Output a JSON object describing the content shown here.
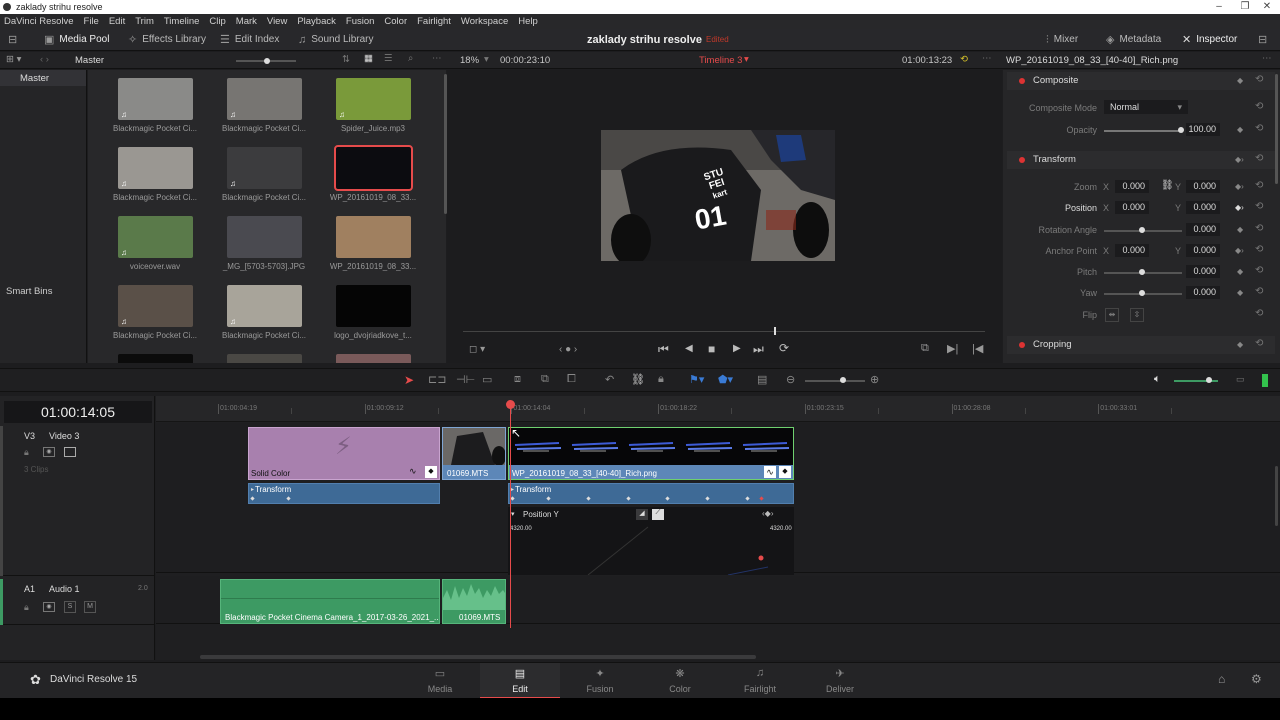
{
  "window": {
    "title": "zaklady strihu resolve"
  },
  "menu": [
    "DaVinci Resolve",
    "File",
    "Edit",
    "Trim",
    "Timeline",
    "Clip",
    "Mark",
    "View",
    "Playback",
    "Fusion",
    "Color",
    "Fairlight",
    "Workspace",
    "Help"
  ],
  "toolbar": {
    "media_pool": "Media Pool",
    "effects_library": "Effects Library",
    "edit_index": "Edit Index",
    "sound_library": "Sound Library",
    "project_name": "zaklady strihu resolve",
    "project_status": "Edited",
    "mixer": "Mixer",
    "metadata": "Metadata",
    "inspector": "Inspector"
  },
  "subbar": {
    "bin": "Master",
    "zoom": "18%",
    "source_tc": "00:00:23:10",
    "timeline_name": "Timeline 3",
    "record_tc": "01:00:13:23",
    "inspector_clip": "WP_20161019_08_33_[40-40]_Rich.png"
  },
  "bins": {
    "master": "Master",
    "smart_bins": "Smart Bins"
  },
  "media": [
    {
      "label": "Blackmagic Pocket Ci...",
      "kind": "video",
      "color": "#8a8a88"
    },
    {
      "label": "Blackmagic Pocket Ci...",
      "kind": "video",
      "color": "#777572"
    },
    {
      "label": "Spider_Juice.mp3",
      "kind": "audio",
      "color": "#7a9a3a"
    },
    {
      "label": "Blackmagic Pocket Ci...",
      "kind": "video",
      "color": "#9a9792"
    },
    {
      "label": "Blackmagic Pocket Ci...",
      "kind": "video",
      "color": "#3c3c3e"
    },
    {
      "label": "WP_20161019_08_33...",
      "kind": "image",
      "color": "#0c0c10"
    },
    {
      "label": "voiceover.wav",
      "kind": "audio",
      "color": "#5a7a4a"
    },
    {
      "label": "_MG_[5703-5703].JPG",
      "kind": "image",
      "color": "#4a4a50"
    },
    {
      "label": "WP_20161019_08_33...",
      "kind": "image",
      "color": "#a08060"
    },
    {
      "label": "Blackmagic Pocket Ci...",
      "kind": "video",
      "color": "#5a5048"
    },
    {
      "label": "Blackmagic Pocket Ci...",
      "kind": "video",
      "color": "#a8a49a"
    },
    {
      "label": "logo_dvojriadkove_t...",
      "kind": "image",
      "color": "#050505"
    }
  ],
  "inspector": {
    "composite": {
      "title": "Composite",
      "mode_label": "Composite Mode",
      "mode_value": "Normal",
      "opacity_label": "Opacity",
      "opacity_value": "100.00"
    },
    "transform": {
      "title": "Transform",
      "zoom_label": "Zoom",
      "zoom_x": "0.000",
      "zoom_y": "0.000",
      "position_label": "Position",
      "position_x": "0.000",
      "position_y": "0.000",
      "rotation_label": "Rotation Angle",
      "rotation_value": "0.000",
      "anchor_label": "Anchor Point",
      "anchor_x": "0.000",
      "anchor_y": "0.000",
      "pitch_label": "Pitch",
      "pitch_value": "0.000",
      "yaw_label": "Yaw",
      "yaw_value": "0.000",
      "flip_label": "Flip",
      "x_axis": "X",
      "y_axis": "Y"
    },
    "cropping": {
      "title": "Cropping"
    }
  },
  "timeline": {
    "timecode": "01:00:14:05",
    "ruler": [
      "01:00:04:19",
      "01:00:09:12",
      "01:00:14:04",
      "01:00:18:22",
      "01:00:23:15",
      "01:00:28:08",
      "01:00:33:01"
    ],
    "v3_id": "V3",
    "v3_name": "Video 3",
    "v3_clips": "3 Clips",
    "a1_id": "A1",
    "a1_name": "Audio 1",
    "a1_level": "2.0",
    "solo": "S",
    "mute": "M",
    "clip_solid": "Solid Color",
    "clip_mts": "01069.MTS",
    "clip_png": "WP_20161019_08_33_[40-40]_Rich.png",
    "transform_label": "Transform",
    "position_y_label": "Position Y",
    "curve_left": "4320.00",
    "curve_right": "4320.00",
    "audio_clip": "Blackmagic Pocket Cinema Camera_1_2017-03-26_2021_...",
    "audio_clip2": "01069.MTS"
  },
  "viewer_overlay": {
    "line1": "STU",
    "line2": "FEI",
    "line3": "kart",
    "number": "01"
  },
  "bottom": {
    "app": "DaVinci Resolve 15",
    "pages": [
      "Media",
      "Edit",
      "Fusion",
      "Color",
      "Fairlight",
      "Deliver"
    ]
  },
  "colors": {
    "accent": "#e64b4b",
    "solid_clip": "#a880ae",
    "video_clip": "#5d87b8",
    "audio_clip": "#3d9a63"
  }
}
